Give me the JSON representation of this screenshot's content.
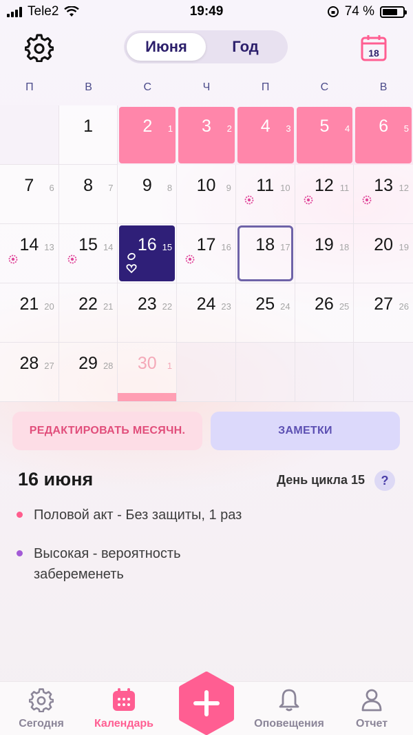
{
  "status_bar": {
    "carrier": "Tele2",
    "time": "19:49",
    "battery": "74 %"
  },
  "header": {
    "tabs": [
      {
        "label": "Июня",
        "active": true
      },
      {
        "label": "Год",
        "active": false
      }
    ],
    "calendar_day_badge": "18"
  },
  "weekdays": [
    "П",
    "В",
    "С",
    "Ч",
    "П",
    "С",
    "В"
  ],
  "calendar": {
    "w1": {
      "d1": "1",
      "d2": "2",
      "c2": "1",
      "d3": "3",
      "c3": "2",
      "d4": "4",
      "c4": "3",
      "d5": "5",
      "c5": "4",
      "d6": "6",
      "c6": "5"
    },
    "w2": {
      "d7": "7",
      "c7": "6",
      "d8": "8",
      "c8": "7",
      "d9": "9",
      "c9": "8",
      "d10": "10",
      "c10": "9",
      "d11": "11",
      "c11": "10",
      "d12": "12",
      "c12": "11",
      "d13": "13",
      "c13": "12"
    },
    "w3": {
      "d14": "14",
      "c14": "13",
      "d15": "15",
      "c15": "14",
      "d16": "16",
      "c16": "15",
      "d17": "17",
      "c17": "16",
      "d18": "18",
      "c18": "17",
      "d19": "19",
      "c19": "18",
      "d20": "20",
      "c20": "19"
    },
    "w4": {
      "d21": "21",
      "c21": "20",
      "d22": "22",
      "c22": "21",
      "d23": "23",
      "c23": "22",
      "d24": "24",
      "c24": "23",
      "d25": "25",
      "c25": "24",
      "d26": "26",
      "c26": "25",
      "d27": "27",
      "c27": "26"
    },
    "w5": {
      "d28": "28",
      "c28": "27",
      "d29": "29",
      "c29": "28",
      "d30": "30",
      "c30": "1"
    }
  },
  "actions": {
    "edit_period": "РЕДАКТИРОВАТЬ МЕСЯЧН.",
    "notes": "ЗАМЕТКИ"
  },
  "details": {
    "date": "16 июня",
    "cycle_day": "День цикла 15",
    "help": "?",
    "entries": [
      {
        "text": "Половой акт - Без защиты, 1 раз",
        "color": "#ff5c8d"
      },
      {
        "text": "Высокая - вероятность забеременеть",
        "color": "#a35ad6"
      }
    ]
  },
  "nav": {
    "today": "Сегодня",
    "calendar": "Календарь",
    "notifications": "Оповещения",
    "report": "Отчет"
  },
  "colors": {
    "period": "#ff86aa",
    "selected": "#2f1f78",
    "accent": "#ff5e92",
    "primary": "#2c1f6b"
  }
}
